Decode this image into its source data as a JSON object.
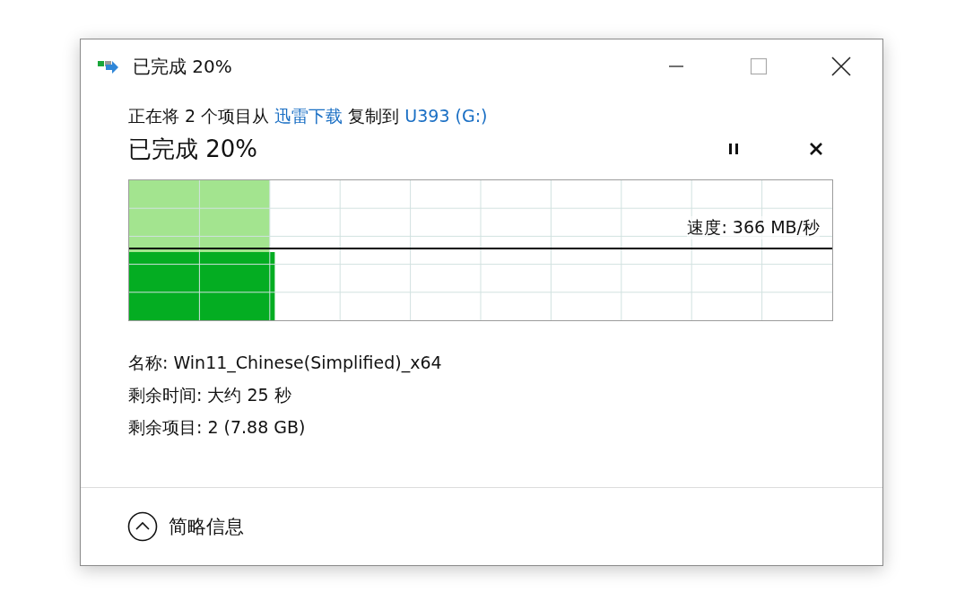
{
  "window": {
    "title": "已完成 20%"
  },
  "description": [
    {
      "kind": "text",
      "text": "正在将 2 个项目从 "
    },
    {
      "kind": "link",
      "text": "迅雷下载"
    },
    {
      "kind": "text",
      "text": " 复制到 "
    },
    {
      "kind": "link",
      "text": "U393 (G:)"
    }
  ],
  "heading": "已完成 20%",
  "progress": {
    "level": 0.2,
    "speed": "速度: 366 MB/秒"
  },
  "details": [
    "名称: Win11_Chinese(Simplified)_x64",
    "剩余时间: 大约 25 秒",
    "剩余项目: 2 (7.88 GB)"
  ],
  "footer": {
    "toggle": "简略信息",
    "expanded": true
  }
}
